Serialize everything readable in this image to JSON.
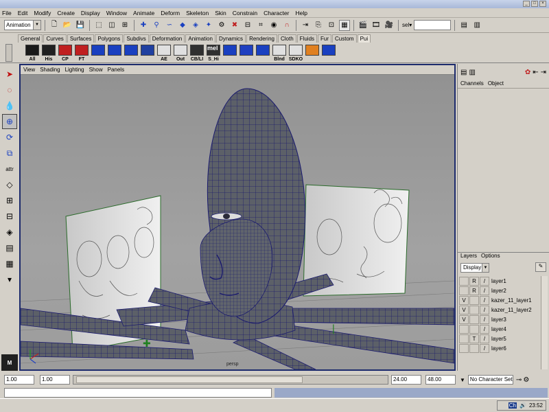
{
  "menubar": [
    "File",
    "Edit",
    "Modify",
    "Create",
    "Display",
    "Window",
    "Animate",
    "Deform",
    "Skeleton",
    "Skin",
    "Constrain",
    "Character",
    "Help"
  ],
  "toolbar": {
    "mode": "Animation",
    "sel_label": "sel▾"
  },
  "shelf_tabs": [
    "General",
    "Curves",
    "Surfaces",
    "Polygons",
    "Subdivs",
    "Deformation",
    "Animation",
    "Dynamics",
    "Rendering",
    "Cloth",
    "Fluids",
    "Fur",
    "Custom",
    "Pui"
  ],
  "shelf_active": "Pui",
  "shelf_buttons": [
    "All",
    "His",
    "CP",
    "FT",
    "",
    "",
    "",
    "",
    "AE",
    "Out",
    "CB/LI",
    "S_Hi",
    "",
    "",
    "",
    "Blnd",
    "SDKO",
    "",
    ""
  ],
  "shelf_mel_label": "mel",
  "toolbox": {
    "attr_label": "attr"
  },
  "viewport": {
    "menu": [
      "View",
      "Shading",
      "Lighting",
      "Show",
      "Panels"
    ],
    "camera_label": "persp"
  },
  "channel_box": {
    "menu": [
      "Channels",
      "Object"
    ]
  },
  "layers": {
    "menu": [
      "Layers",
      "Options"
    ],
    "display": "Display",
    "items": [
      {
        "v": "",
        "r": "R",
        "name": "layer1"
      },
      {
        "v": "",
        "r": "R",
        "name": "layer2"
      },
      {
        "v": "V",
        "r": "",
        "name": "kazer_11_layer1"
      },
      {
        "v": "V",
        "r": "",
        "name": "kazer_11_layer2"
      },
      {
        "v": "V",
        "r": "",
        "name": "layer3"
      },
      {
        "v": "",
        "r": "",
        "name": "layer4"
      },
      {
        "v": "",
        "r": "T",
        "name": "layer5"
      },
      {
        "v": "",
        "r": "",
        "name": "layer6"
      }
    ]
  },
  "timeline": {
    "start": "1.00",
    "playback_start": "1.00",
    "range_start": "1",
    "range_end": "24",
    "playback_end": "24.00",
    "end": "48.00",
    "character_set": "No Character Set"
  },
  "taskbar": {
    "time": "23:52",
    "lang": "Ch"
  },
  "colors": {
    "viewport_border": "#1c2a6c",
    "mesh_fill": "#5c6068",
    "wire": "#1a1a6e"
  }
}
